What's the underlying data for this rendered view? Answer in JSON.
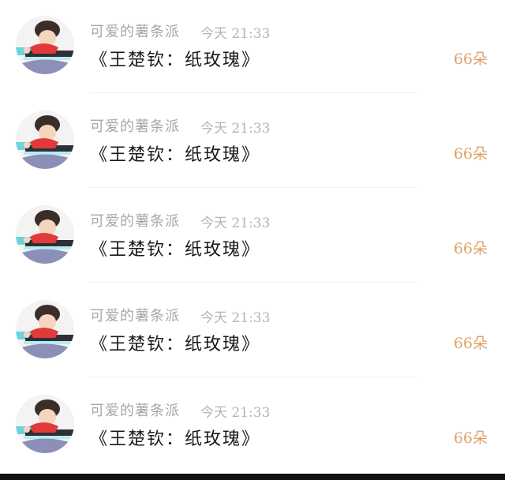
{
  "colors": {
    "username": "#a7a7a7",
    "time": "#b4b4b4",
    "message": "#1a1a1a",
    "count": "#e2a169",
    "bottom_bar": "#111111"
  },
  "gifts": [
    {
      "username": "可爱的薯条派",
      "time": "今天 21:33",
      "message": "《王楚钦：纸玫瑰》",
      "count": "66朵",
      "avatar_icon": "cartoon-boy-table-tennis-avatar"
    },
    {
      "username": "可爱的薯条派",
      "time": "今天 21:33",
      "message": "《王楚钦：纸玫瑰》",
      "count": "66朵",
      "avatar_icon": "cartoon-boy-table-tennis-avatar"
    },
    {
      "username": "可爱的薯条派",
      "time": "今天 21:33",
      "message": "《王楚钦：纸玫瑰》",
      "count": "66朵",
      "avatar_icon": "cartoon-boy-table-tennis-avatar"
    },
    {
      "username": "可爱的薯条派",
      "time": "今天 21:33",
      "message": "《王楚钦：纸玫瑰》",
      "count": "66朵",
      "avatar_icon": "cartoon-boy-table-tennis-avatar"
    },
    {
      "username": "可爱的薯条派",
      "time": "今天 21:33",
      "message": "《王楚钦：纸玫瑰》",
      "count": "66朵",
      "avatar_icon": "cartoon-boy-table-tennis-avatar"
    }
  ]
}
